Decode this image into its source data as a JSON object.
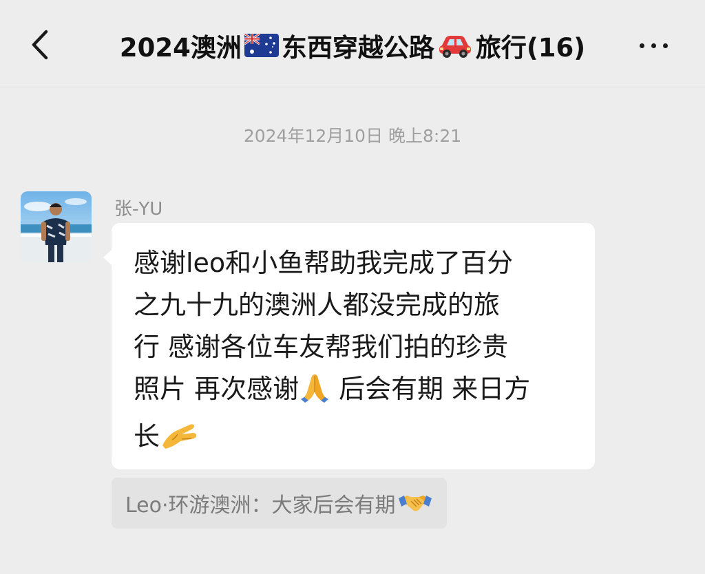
{
  "nav": {
    "title_prefix": "2024澳洲",
    "title_middle": "东西穿越公路",
    "title_suffix": "旅行(16)",
    "back_icon": "chevron-left-icon",
    "more_icon": "more-dots-icon"
  },
  "chat": {
    "timestamp": "2024年12月10日 晚上8:21",
    "message": {
      "sender": "张-YU",
      "lines": [
        "感谢leo和小鱼帮助我完成了百分",
        "之九十九的澳洲人都没完成的旅",
        "行 感谢各位车友帮我们拍的珍贵",
        "照片 再次感谢",
        " 后会有期 来日方",
        "长"
      ]
    },
    "quote": {
      "text": "Leo·环游澳洲：大家后会有期"
    }
  },
  "colors": {
    "background": "#ededed",
    "bubble": "#ffffff",
    "quote_bg": "#e3e3e3",
    "muted_text": "#9f9f9f"
  }
}
